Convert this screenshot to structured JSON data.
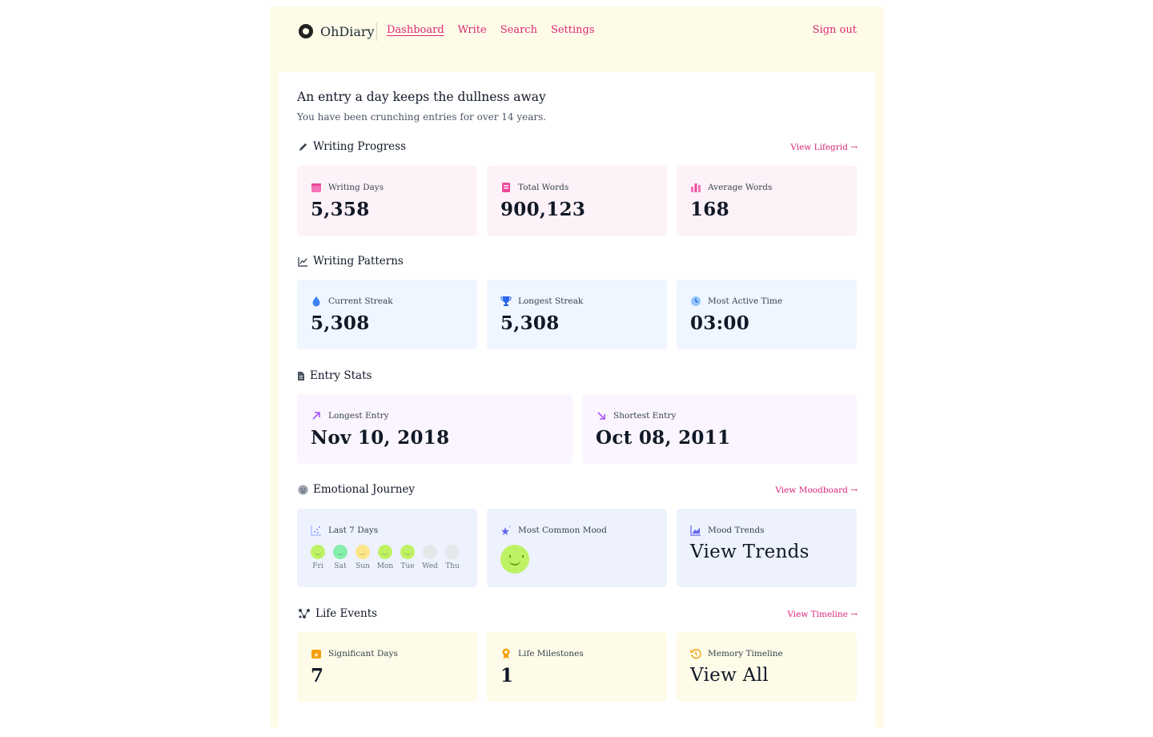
{
  "header": {
    "brand": "OhDiary",
    "nav": [
      "Dashboard",
      "Write",
      "Search",
      "Settings"
    ],
    "active": "Dashboard",
    "signout": "Sign out"
  },
  "intro": {
    "headline": "An entry a day keeps the dullness away",
    "subline": "You have been crunching entries for over 14 years."
  },
  "writing_progress": {
    "title": "Writing Progress",
    "link": "View Lifegrid →",
    "cards": [
      {
        "label": "Writing Days",
        "value": "5,358",
        "icon": "calendar-icon"
      },
      {
        "label": "Total Words",
        "value": "900,123",
        "icon": "book-icon"
      },
      {
        "label": "Average Words",
        "value": "168",
        "icon": "bar-chart-icon"
      }
    ]
  },
  "writing_patterns": {
    "title": "Writing Patterns",
    "cards": [
      {
        "label": "Current Streak",
        "value": "5,308",
        "icon": "drop-icon"
      },
      {
        "label": "Longest Streak",
        "value": "5,308",
        "icon": "trophy-icon"
      },
      {
        "label": "Most Active Time",
        "value": "03:00",
        "icon": "clock-icon"
      }
    ]
  },
  "entry_stats": {
    "title": "Entry Stats",
    "cards": [
      {
        "label": "Longest Entry",
        "value": "Nov 10, 2018",
        "icon": "arrow-up-right-icon"
      },
      {
        "label": "Shortest Entry",
        "value": "Oct 08, 2011",
        "icon": "arrow-down-right-icon"
      }
    ]
  },
  "emotional_journey": {
    "title": "Emotional Journey",
    "link": "View Moodboard →",
    "last7": {
      "label": "Last 7 Days",
      "days": [
        "Fri",
        "Sat",
        "Sun",
        "Mon",
        "Tue",
        "Wed",
        "Thu"
      ]
    },
    "common_mood": {
      "label": "Most Common Mood"
    },
    "trends": {
      "label": "Mood Trends",
      "value": "View Trends"
    }
  },
  "life_events": {
    "title": "Life Events",
    "link": "View Timeline →",
    "cards": [
      {
        "label": "Significant Days",
        "value": "7",
        "icon": "calendar-star-icon"
      },
      {
        "label": "Life Milestones",
        "value": "1",
        "icon": "medal-icon"
      },
      {
        "label": "Memory Timeline",
        "value": "View All",
        "icon": "history-icon"
      }
    ]
  },
  "colors": {
    "accent": "#db2777",
    "shell": "#fefce8",
    "pink_card": "#fdf2f8",
    "blue_card": "#eff6ff",
    "purple_card": "#faf5ff",
    "indigo_card": "#eef2ff",
    "yellow_card": "#fefce8"
  }
}
